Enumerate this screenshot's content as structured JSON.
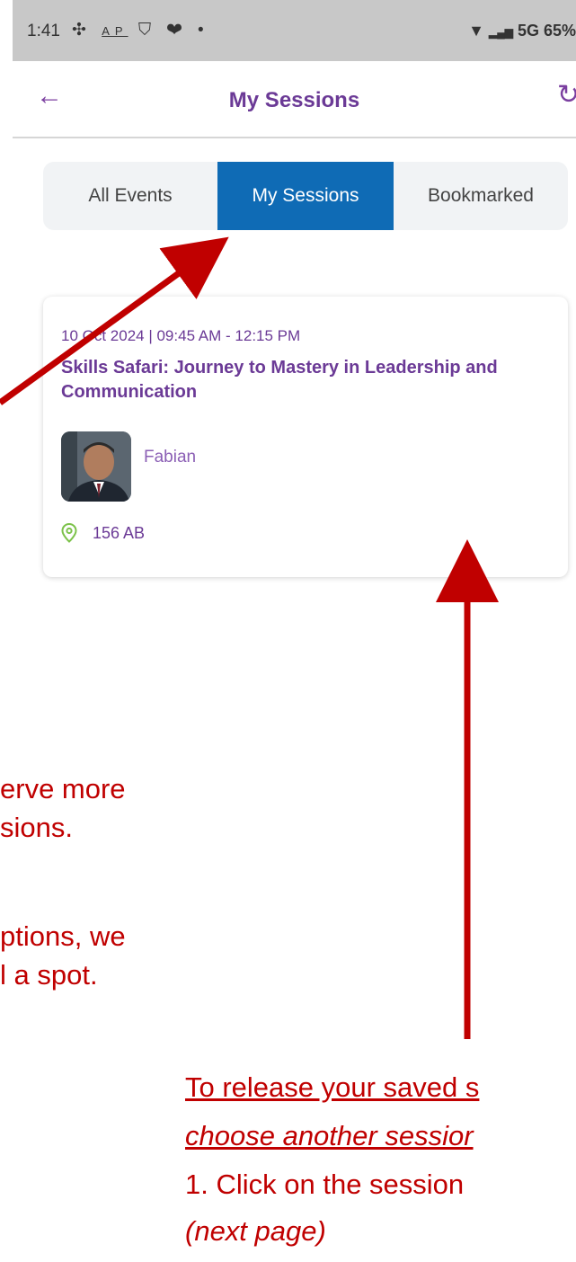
{
  "status_bar": {
    "time": "1:41",
    "icons": [
      "slack-icon",
      "ap-icon",
      "shield-icon",
      "heart-icon",
      "dot-icon"
    ],
    "right_text": "5G 65%"
  },
  "header": {
    "title": "My Sessions"
  },
  "tabs": [
    {
      "label": "All Events",
      "active": false
    },
    {
      "label": "My Sessions",
      "active": true
    },
    {
      "label": "Bookmarked",
      "active": false
    }
  ],
  "session_card": {
    "date_time": "10 Oct 2024 | 09:45 AM - 12:15 PM",
    "title": "Skills Safari: Journey to Mastery in Leadership and Communication",
    "speaker": "Fabian",
    "location": "156 AB"
  },
  "annotations": {
    "left_line1": "erve more",
    "left_line2": "sions.",
    "left_line3": "ptions, we",
    "left_line4": "l a spot.",
    "bottom_line1": "To release your saved s",
    "bottom_line2": "choose another sessior",
    "bottom_line3": "1. Click on the session",
    "bottom_line4": "(next page)"
  },
  "colors": {
    "accent_purple": "#6b3a96",
    "active_tab_blue": "#0f6bb5",
    "annotation_red": "#c00000",
    "location_green": "#7cc24a"
  }
}
